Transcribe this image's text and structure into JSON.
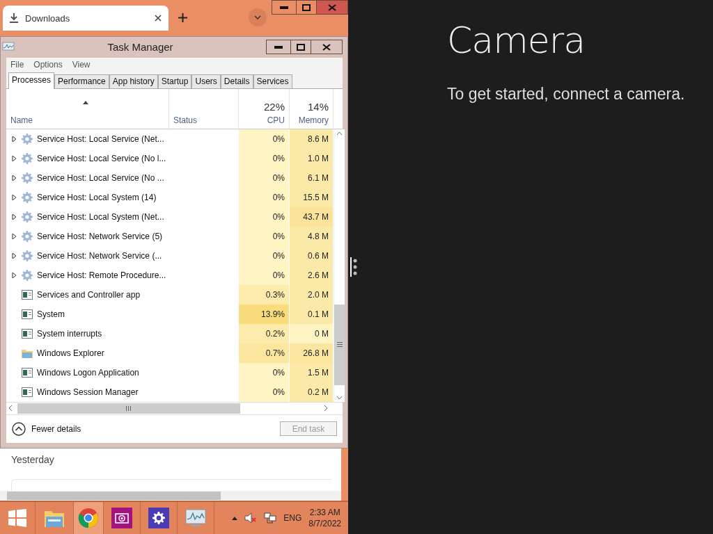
{
  "browser": {
    "tab": {
      "title": "Downloads",
      "selected": true
    },
    "content": {
      "section": "Yesterday"
    }
  },
  "task_manager": {
    "title": "Task Manager",
    "menu": [
      "File",
      "Options",
      "View"
    ],
    "tabs": [
      {
        "label": "Processes",
        "selected": true
      },
      {
        "label": "Performance",
        "selected": false
      },
      {
        "label": "App history",
        "selected": false
      },
      {
        "label": "Startup",
        "selected": false
      },
      {
        "label": "Users",
        "selected": false
      },
      {
        "label": "Details",
        "selected": false
      },
      {
        "label": "Services",
        "selected": false
      }
    ],
    "columns": {
      "name": "Name",
      "status": "Status",
      "cpu": {
        "total": "22%",
        "label": "CPU"
      },
      "memory": {
        "total": "14%",
        "label": "Memory"
      }
    },
    "rows": [
      {
        "kind": "service",
        "name": "Service Host: Local Service (Net...",
        "cpu": {
          "value": "0%",
          "color": "#fff4c4"
        },
        "memory": {
          "value": "8.6 M",
          "color": "#fbe9a8"
        }
      },
      {
        "kind": "service",
        "name": "Service Host: Local Service (No l...",
        "cpu": {
          "value": "0%",
          "color": "#fff4c4"
        },
        "memory": {
          "value": "1.0 M",
          "color": "#fbe9a8"
        }
      },
      {
        "kind": "service",
        "name": "Service Host: Local Service (No ...",
        "cpu": {
          "value": "0%",
          "color": "#fff4c4"
        },
        "memory": {
          "value": "6.1 M",
          "color": "#fbe9a8"
        }
      },
      {
        "kind": "service",
        "name": "Service Host: Local System (14)",
        "cpu": {
          "value": "0%",
          "color": "#fff4c4"
        },
        "memory": {
          "value": "15.5 M",
          "color": "#fbe9a8"
        }
      },
      {
        "kind": "service",
        "name": "Service Host: Local System (Net...",
        "cpu": {
          "value": "0%",
          "color": "#fff4c4"
        },
        "memory": {
          "value": "43.7 M",
          "color": "#fbe39a"
        }
      },
      {
        "kind": "service",
        "name": "Service Host: Network Service (5)",
        "cpu": {
          "value": "0%",
          "color": "#fff4c4"
        },
        "memory": {
          "value": "4.8 M",
          "color": "#fbe9a8"
        }
      },
      {
        "kind": "service",
        "name": "Service Host: Network Service (...",
        "cpu": {
          "value": "0%",
          "color": "#fff4c4"
        },
        "memory": {
          "value": "0.6 M",
          "color": "#fbe9a8"
        }
      },
      {
        "kind": "service",
        "name": "Service Host: Remote Procedure...",
        "cpu": {
          "value": "0%",
          "color": "#fff4c4"
        },
        "memory": {
          "value": "2.6 M",
          "color": "#fbe9a8"
        }
      },
      {
        "kind": "app",
        "name": "Services and Controller app",
        "cpu": {
          "value": "0.3%",
          "color": "#fcebab"
        },
        "memory": {
          "value": "2.0 M",
          "color": "#fbe9a8"
        }
      },
      {
        "kind": "app",
        "name": "System",
        "cpu": {
          "value": "13.9%",
          "color": "#f9dc7c"
        },
        "memory": {
          "value": "0.1 M",
          "color": "#fbe9a8"
        }
      },
      {
        "kind": "app",
        "name": "System interrupts",
        "cpu": {
          "value": "0.2%",
          "color": "#fcebab"
        },
        "memory": {
          "value": "0 M",
          "color": "#fff4c4"
        }
      },
      {
        "kind": "folder",
        "name": "Windows Explorer",
        "cpu": {
          "value": "0.7%",
          "color": "#fbe6a0"
        },
        "memory": {
          "value": "26.8 M",
          "color": "#fbe6a0"
        }
      },
      {
        "kind": "app",
        "name": "Windows Logon Application",
        "cpu": {
          "value": "0%",
          "color": "#fff4c4"
        },
        "memory": {
          "value": "1.5 M",
          "color": "#fbe9a8"
        }
      },
      {
        "kind": "app",
        "name": "Windows Session Manager",
        "cpu": {
          "value": "0%",
          "color": "#fff4c4"
        },
        "memory": {
          "value": "0.2 M",
          "color": "#fbe9a8"
        }
      }
    ],
    "footer": {
      "toggle": "Fewer details",
      "end_task": {
        "label": "End task",
        "disabled": true
      }
    }
  },
  "taskbar": {
    "pinned": [
      {
        "kind": "start"
      },
      {
        "kind": "explorer"
      },
      {
        "kind": "browser",
        "selected": true
      },
      {
        "kind": "camera",
        "selected": false
      },
      {
        "kind": "settings",
        "selected": false
      },
      {
        "kind": "taskmanager",
        "selected": false
      }
    ],
    "language": "ENG",
    "time": "2:33 AM",
    "date": "8/7/2022"
  },
  "camera_app": {
    "title": "Camera",
    "message": "To get started, connect a camera."
  }
}
